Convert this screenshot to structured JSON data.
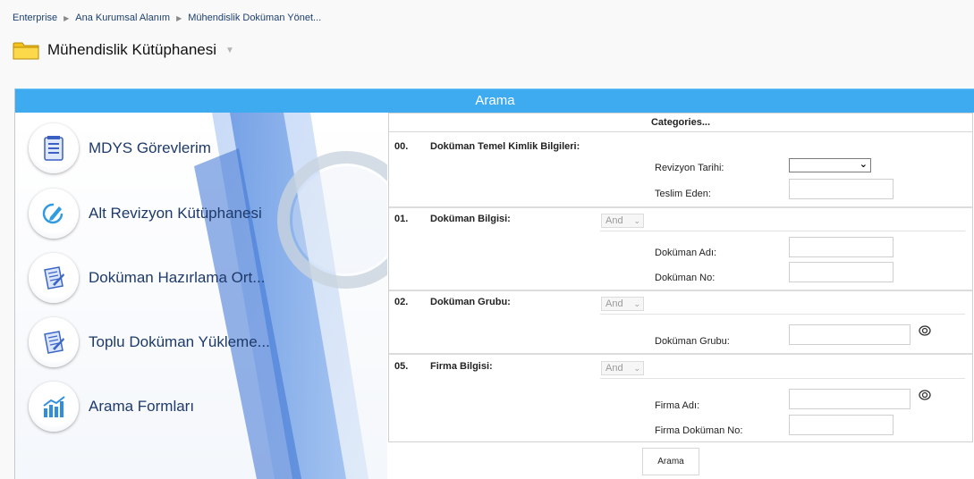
{
  "breadcrumb": {
    "items": [
      "Enterprise",
      "Ana Kurumsal Alanım",
      "Mühendislik Doküman Yönet..."
    ]
  },
  "header": {
    "title": "Mühendislik Kütüphanesi",
    "folder_icon": "folder-icon",
    "dropdown_icon": "chevron-down-icon"
  },
  "panel": {
    "title": "Arama",
    "accent_color": "#3eaaf0"
  },
  "menu": {
    "items": [
      {
        "label": "MDYS Görevlerim",
        "icon": "task-list-icon"
      },
      {
        "label": "Alt Revizyon Kütüphanesi",
        "icon": "edit-revision-icon"
      },
      {
        "label": "Doküman Hazırlama Ort...",
        "icon": "document-prep-icon"
      },
      {
        "label": "Toplu Doküman Yükleme...",
        "icon": "bulk-upload-icon"
      },
      {
        "label": "Arama Formları",
        "icon": "bar-chart-icon"
      }
    ]
  },
  "form": {
    "categories_label": "Categories...",
    "sections": [
      {
        "num": "00.",
        "title": "Doküman Temel Kimlik Bilgileri:",
        "fields": [
          {
            "label": "Revizyon Tarihi:",
            "type": "select",
            "value": ""
          },
          {
            "label": "Teslim Eden:",
            "type": "text",
            "value": ""
          }
        ]
      },
      {
        "num": "01.",
        "title": "Doküman Bilgisi:",
        "operator": "And",
        "fields": [
          {
            "label": "Doküman Adı:",
            "type": "text",
            "value": ""
          },
          {
            "label": "Doküman No:",
            "type": "text",
            "value": ""
          }
        ]
      },
      {
        "num": "02.",
        "title": "Doküman Grubu:",
        "operator": "And",
        "fields": [
          {
            "label": "Doküman Grubu:",
            "type": "text",
            "value": ""
          }
        ]
      },
      {
        "num": "05.",
        "title": "Firma Bilgisi:",
        "operator": "And",
        "fields": [
          {
            "label": "Firma Adı:",
            "type": "text",
            "value": ""
          },
          {
            "label": "Firma Doküman No:",
            "type": "text",
            "value": ""
          }
        ]
      }
    ],
    "search_button": "Arama"
  }
}
